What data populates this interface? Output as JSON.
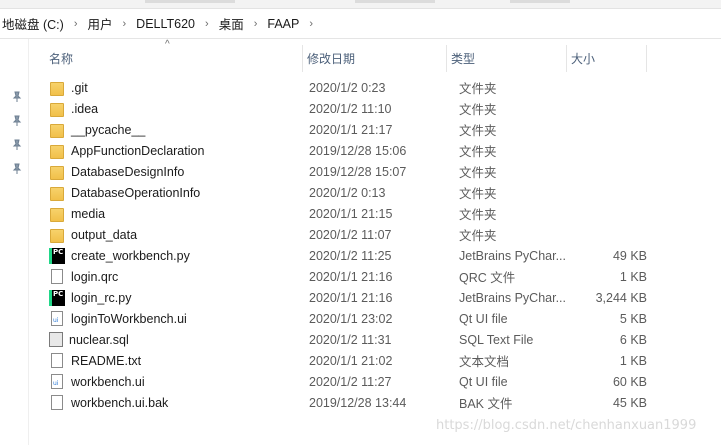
{
  "breadcrumb": [
    "地磁盘 (C:)",
    "用户",
    "DELLT620",
    "桌面",
    "FAAP"
  ],
  "columns": {
    "name": "名称",
    "date": "修改日期",
    "type": "类型",
    "size": "大小"
  },
  "files": [
    {
      "name": ".git",
      "date": "2020/1/2 0:23",
      "type": "文件夹",
      "size": "",
      "icon": "folder-icon"
    },
    {
      "name": ".idea",
      "date": "2020/1/2 11:10",
      "type": "文件夹",
      "size": "",
      "icon": "folder-icon"
    },
    {
      "name": "__pycache__",
      "date": "2020/1/1 21:17",
      "type": "文件夹",
      "size": "",
      "icon": "folder-icon"
    },
    {
      "name": "AppFunctionDeclaration",
      "date": "2019/12/28 15:06",
      "type": "文件夹",
      "size": "",
      "icon": "folder-icon"
    },
    {
      "name": "DatabaseDesignInfo",
      "date": "2019/12/28 15:07",
      "type": "文件夹",
      "size": "",
      "icon": "folder-icon"
    },
    {
      "name": "DatabaseOperationInfo",
      "date": "2020/1/2 0:13",
      "type": "文件夹",
      "size": "",
      "icon": "folder-icon"
    },
    {
      "name": "media",
      "date": "2020/1/1 21:15",
      "type": "文件夹",
      "size": "",
      "icon": "folder-icon"
    },
    {
      "name": "output_data",
      "date": "2020/1/2 11:07",
      "type": "文件夹",
      "size": "",
      "icon": "folder-icon"
    },
    {
      "name": "create_workbench.py",
      "date": "2020/1/2 11:25",
      "type": "JetBrains PyChar...",
      "size": "49 KB",
      "icon": "pycharm-icon"
    },
    {
      "name": "login.qrc",
      "date": "2020/1/1 21:16",
      "type": "QRC 文件",
      "size": "1 KB",
      "icon": "file-icon"
    },
    {
      "name": "login_rc.py",
      "date": "2020/1/1 21:16",
      "type": "JetBrains PyChar...",
      "size": "3,244 KB",
      "icon": "pycharm-icon"
    },
    {
      "name": "loginToWorkbench.ui",
      "date": "2020/1/1 23:02",
      "type": "Qt UI file",
      "size": "5 KB",
      "icon": "ui-file-icon"
    },
    {
      "name": "nuclear.sql",
      "date": "2020/1/2 11:31",
      "type": "SQL Text File",
      "size": "6 KB",
      "icon": "sql-file-icon"
    },
    {
      "name": "README.txt",
      "date": "2020/1/1 21:02",
      "type": "文本文档",
      "size": "1 KB",
      "icon": "file-icon"
    },
    {
      "name": "workbench.ui",
      "date": "2020/1/2 11:27",
      "type": "Qt UI file",
      "size": "60 KB",
      "icon": "ui-file-icon"
    },
    {
      "name": "workbench.ui.bak",
      "date": "2019/12/28 13:44",
      "type": "BAK 文件",
      "size": "45 KB",
      "icon": "file-icon"
    }
  ],
  "watermark": "https://blog.csdn.net/chenhanxuan1999"
}
